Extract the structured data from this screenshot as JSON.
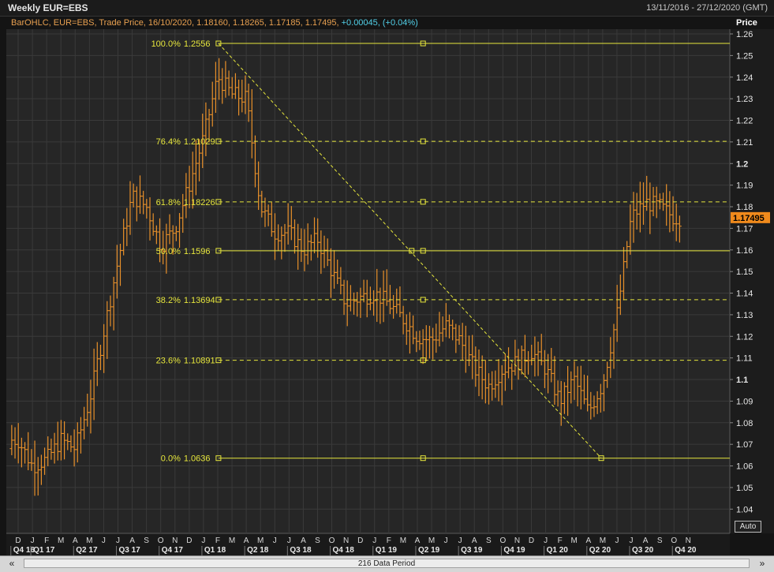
{
  "header": {
    "title": "Weekly EUR=EBS",
    "date_range": "13/11/2016 - 27/12/2020 (GMT)"
  },
  "legend": {
    "main": "BarOHLC, EUR=EBS, Trade Price, 16/10/2020, 1.18160, 1.18265, 1.17185, 1.17495,",
    "change": "+0.00045, (+0.04%)"
  },
  "price_axis_title": "Price",
  "auto_label": "Auto",
  "scrollbar": {
    "left_arrow": "«",
    "right_arrow": "»",
    "period_label": "216 Data Period"
  },
  "colors": {
    "background": "#141414",
    "bars": "#e8902a",
    "fib_lines": "#e6e63c",
    "last_price_bg": "#f08a1c",
    "cyan": "#52d0e8"
  },
  "chart_data": {
    "type": "ohlc_bar",
    "instrument": "EUR=EBS",
    "interval": "Weekly",
    "ylim": [
      1.035,
      1.26
    ],
    "y_ticks": [
      "1.26",
      "1.25",
      "1.24",
      "1.23",
      "1.22",
      "1.21",
      "1.2",
      "1.19",
      "1.18",
      "1.17",
      "1.16",
      "1.15",
      "1.14",
      "1.13",
      "1.12",
      "1.11",
      "1.1",
      "1.09",
      "1.08",
      "1.07",
      "1.06",
      "1.05",
      "1.04"
    ],
    "y_ticks_bold": [
      "1.2",
      "1.1"
    ],
    "last_price": "1.17495",
    "months": [
      "D",
      "J",
      "F",
      "M",
      "A",
      "M",
      "J",
      "J",
      "A",
      "S",
      "O",
      "N",
      "D",
      "J",
      "F",
      "M",
      "A",
      "M",
      "J",
      "J",
      "A",
      "S",
      "O",
      "N",
      "D",
      "J",
      "F",
      "M",
      "A",
      "M",
      "J",
      "J",
      "A",
      "S",
      "O",
      "N",
      "D",
      "J",
      "F",
      "M",
      "A",
      "M",
      "J",
      "J",
      "A",
      "S",
      "O",
      "N"
    ],
    "quarters": [
      "Q4 16",
      "Q1 17",
      "Q2 17",
      "Q3 17",
      "Q4 17",
      "Q1 18",
      "Q2 18",
      "Q3 18",
      "Q4 18",
      "Q1 19",
      "Q2 19",
      "Q3 19",
      "Q4 19",
      "Q1 20",
      "Q2 20",
      "Q3 20",
      "Q4 20"
    ],
    "month_anchors": [
      {
        "m": 0,
        "p": 1.072
      },
      {
        "m": 1,
        "p": 1.06
      },
      {
        "m": 2,
        "p": 1.063
      },
      {
        "m": 3,
        "p": 1.072
      },
      {
        "m": 4,
        "p": 1.068
      },
      {
        "m": 5,
        "p": 1.09
      },
      {
        "m": 6,
        "p": 1.122
      },
      {
        "m": 7,
        "p": 1.155
      },
      {
        "m": 8,
        "p": 1.185
      },
      {
        "m": 9,
        "p": 1.18
      },
      {
        "m": 10,
        "p": 1.162
      },
      {
        "m": 11,
        "p": 1.17
      },
      {
        "m": 12,
        "p": 1.19
      },
      {
        "m": 13,
        "p": 1.212
      },
      {
        "m": 14,
        "p": 1.24
      },
      {
        "m": 15,
        "p": 1.232
      },
      {
        "m": 16,
        "p": 1.23
      },
      {
        "m": 17,
        "p": 1.18
      },
      {
        "m": 18,
        "p": 1.168
      },
      {
        "m": 19,
        "p": 1.168
      },
      {
        "m": 20,
        "p": 1.16
      },
      {
        "m": 21,
        "p": 1.165
      },
      {
        "m": 22,
        "p": 1.15
      },
      {
        "m": 23,
        "p": 1.135
      },
      {
        "m": 24,
        "p": 1.138
      },
      {
        "m": 25,
        "p": 1.14
      },
      {
        "m": 26,
        "p": 1.135
      },
      {
        "m": 27,
        "p": 1.128
      },
      {
        "m": 28,
        "p": 1.12
      },
      {
        "m": 29,
        "p": 1.118
      },
      {
        "m": 30,
        "p": 1.125
      },
      {
        "m": 31,
        "p": 1.118
      },
      {
        "m": 32,
        "p": 1.105
      },
      {
        "m": 33,
        "p": 1.097
      },
      {
        "m": 34,
        "p": 1.105
      },
      {
        "m": 35,
        "p": 1.108
      },
      {
        "m": 36,
        "p": 1.113
      },
      {
        "m": 37,
        "p": 1.105
      },
      {
        "m": 38,
        "p": 1.09
      },
      {
        "m": 39,
        "p": 1.1
      },
      {
        "m": 40,
        "p": 1.085
      },
      {
        "m": 41,
        "p": 1.098
      },
      {
        "m": 42,
        "p": 1.13
      },
      {
        "m": 43,
        "p": 1.175
      },
      {
        "m": 44,
        "p": 1.182
      },
      {
        "m": 45,
        "p": 1.18
      },
      {
        "m": 46,
        "p": 1.175
      },
      {
        "m": 46.6,
        "p": 1.17495
      }
    ],
    "fibonacci": [
      {
        "pct": "100.0%",
        "value": 1.2556,
        "label": "1.2556",
        "style": "solid"
      },
      {
        "pct": "76.4%",
        "value": 1.21029,
        "label": "1.21029",
        "style": "dashed"
      },
      {
        "pct": "61.8%",
        "value": 1.18226,
        "label": "1.18226",
        "style": "dashed"
      },
      {
        "pct": "50.0%",
        "value": 1.1596,
        "label": "1.1596",
        "style": "solid"
      },
      {
        "pct": "38.2%",
        "value": 1.13694,
        "label": "1.13694",
        "style": "dashed"
      },
      {
        "pct": "23.6%",
        "value": 1.10891,
        "label": "1.10891",
        "style": "dashed"
      },
      {
        "pct": "0.0%",
        "value": 1.0636,
        "label": "1.0636",
        "style": "solid"
      }
    ],
    "fib_trend": {
      "start_month": 14.05,
      "start_value": 1.2556,
      "end_month": 40.9,
      "end_value": 1.0636
    },
    "fib_mid_month": 28.4,
    "fib_midpoint_month": 27.6
  }
}
